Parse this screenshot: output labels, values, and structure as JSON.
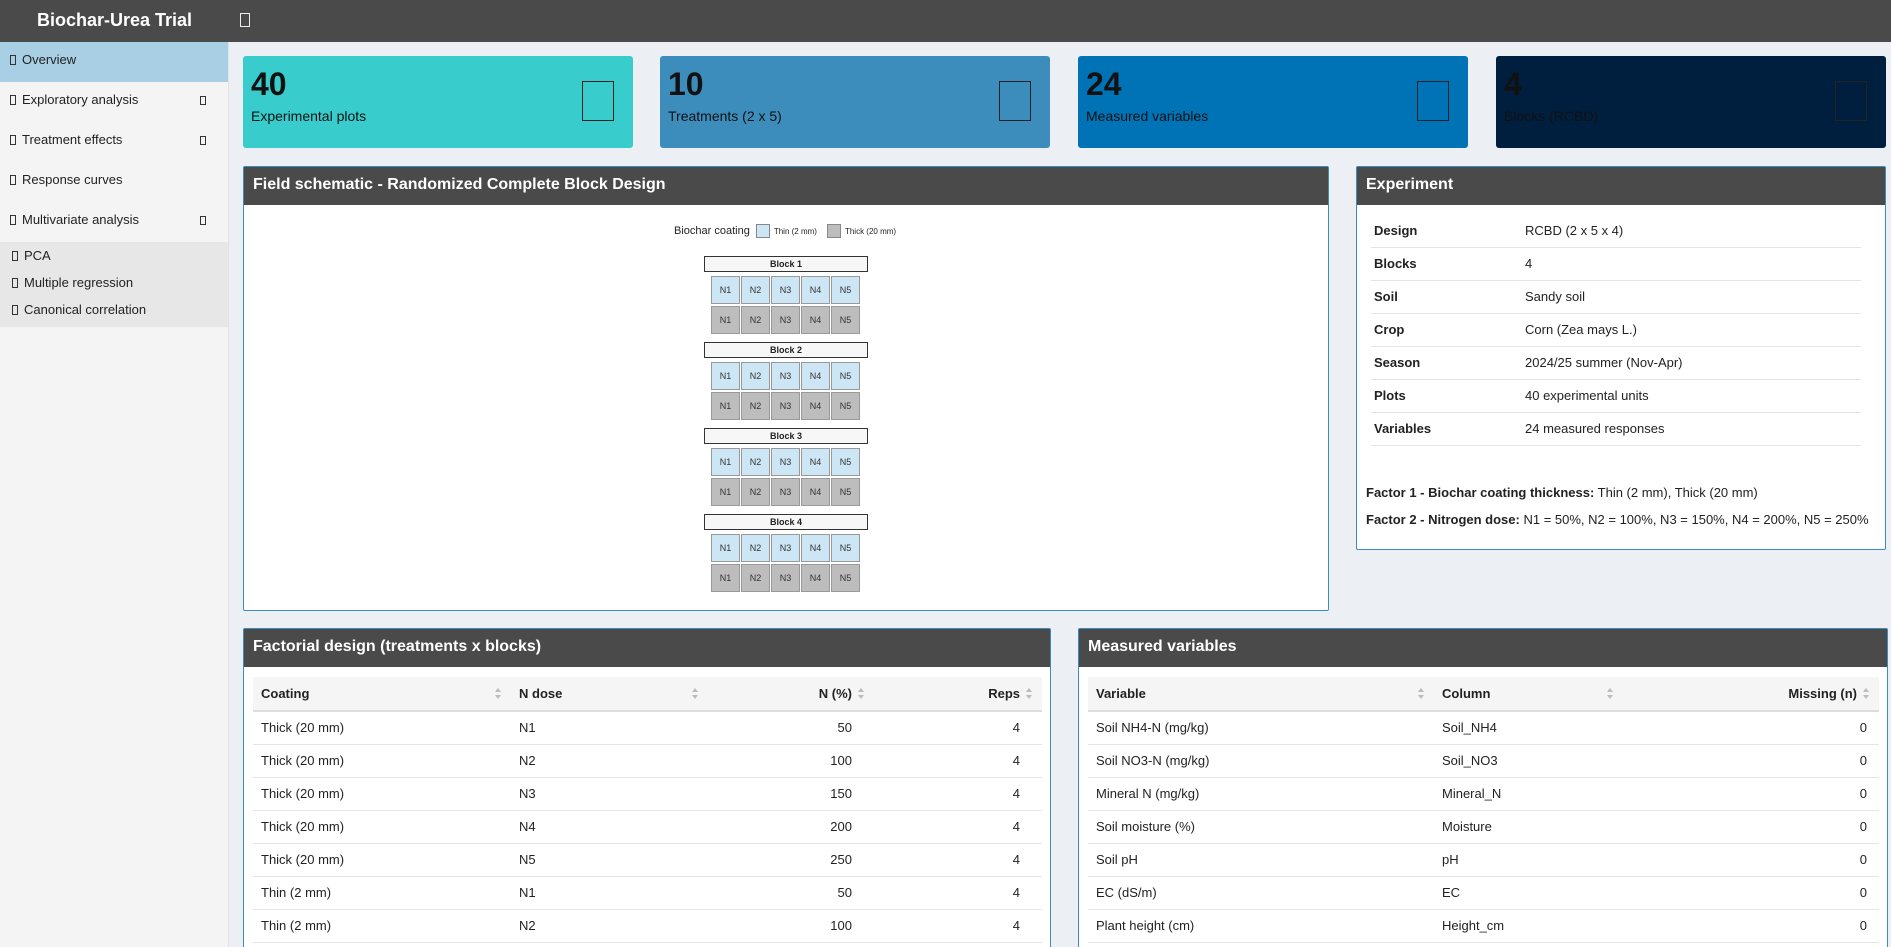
{
  "app": {
    "title": "Biochar-Urea Trial"
  },
  "sidebar": {
    "items": [
      {
        "label": "Overview"
      },
      {
        "label": "Exploratory analysis"
      },
      {
        "label": "Treatment effects"
      },
      {
        "label": "Response curves"
      },
      {
        "label": "Multivariate analysis"
      }
    ],
    "submenu": [
      {
        "label": "PCA"
      },
      {
        "label": "Multiple regression"
      },
      {
        "label": "Canonical correlation"
      }
    ]
  },
  "value_boxes": [
    {
      "value": "40",
      "label": "Experimental plots",
      "color": "#39cccc"
    },
    {
      "value": "10",
      "label": "Treatments (2 x 5)",
      "color": "#3c8dbc"
    },
    {
      "value": "24",
      "label": "Measured variables",
      "color": "#0073b7"
    },
    {
      "value": "4",
      "label": "Blocks (RCBD)",
      "color": "#001f3f"
    }
  ],
  "schematic": {
    "title": "Field schematic - Randomized Complete Block Design",
    "legend_title": "Biochar coating",
    "legend_thin": "Thin (2 mm)",
    "legend_thick": "Thick (20 mm)",
    "colors": {
      "thin": "#cde6f5",
      "thick": "#bdbdbd"
    },
    "blocks": [
      "Block 1",
      "Block 2",
      "Block 3",
      "Block 4"
    ],
    "n_levels": [
      "N1",
      "N2",
      "N3",
      "N4",
      "N5"
    ]
  },
  "experiment": {
    "title": "Experiment",
    "rows": [
      {
        "k": "Design",
        "v": "RCBD (2 x 5 x 4)"
      },
      {
        "k": "Blocks",
        "v": "4"
      },
      {
        "k": "Soil",
        "v": "Sandy soil"
      },
      {
        "k": "Crop",
        "v": "Corn (Zea mays L.)"
      },
      {
        "k": "Season",
        "v": "2024/25 summer (Nov-Apr)"
      },
      {
        "k": "Plots",
        "v": "40 experimental units"
      },
      {
        "k": "Variables",
        "v": "24 measured responses"
      }
    ],
    "factor1_label": "Factor 1 - Biochar coating thickness:",
    "factor1_text": " Thin (2 mm), Thick (20 mm)",
    "factor2_label": "Factor 2 - Nitrogen dose:",
    "factor2_text": " N1 = 50%, N2 = 100%, N3 = 150%, N4 = 200%, N5 = 250%"
  },
  "factorial": {
    "title": "Factorial design (treatments x blocks)",
    "headers": [
      "Coating",
      "N dose",
      "N (%)",
      "Reps"
    ],
    "rows": [
      [
        "Thick (20 mm)",
        "N1",
        "50",
        "4"
      ],
      [
        "Thick (20 mm)",
        "N2",
        "100",
        "4"
      ],
      [
        "Thick (20 mm)",
        "N3",
        "150",
        "4"
      ],
      [
        "Thick (20 mm)",
        "N4",
        "200",
        "4"
      ],
      [
        "Thick (20 mm)",
        "N5",
        "250",
        "4"
      ],
      [
        "Thin (2 mm)",
        "N1",
        "50",
        "4"
      ],
      [
        "Thin (2 mm)",
        "N2",
        "100",
        "4"
      ]
    ]
  },
  "variables": {
    "title": "Measured variables",
    "headers": [
      "Variable",
      "Column",
      "Missing (n)"
    ],
    "rows": [
      [
        "Soil NH4-N (mg/kg)",
        "Soil_NH4",
        "0"
      ],
      [
        "Soil NO3-N (mg/kg)",
        "Soil_NO3",
        "0"
      ],
      [
        "Mineral N (mg/kg)",
        "Mineral_N",
        "0"
      ],
      [
        "Soil moisture (%)",
        "Moisture",
        "0"
      ],
      [
        "Soil pH",
        "pH",
        "0"
      ],
      [
        "EC (dS/m)",
        "EC",
        "0"
      ],
      [
        "Plant height (cm)",
        "Height_cm",
        "0"
      ]
    ]
  }
}
